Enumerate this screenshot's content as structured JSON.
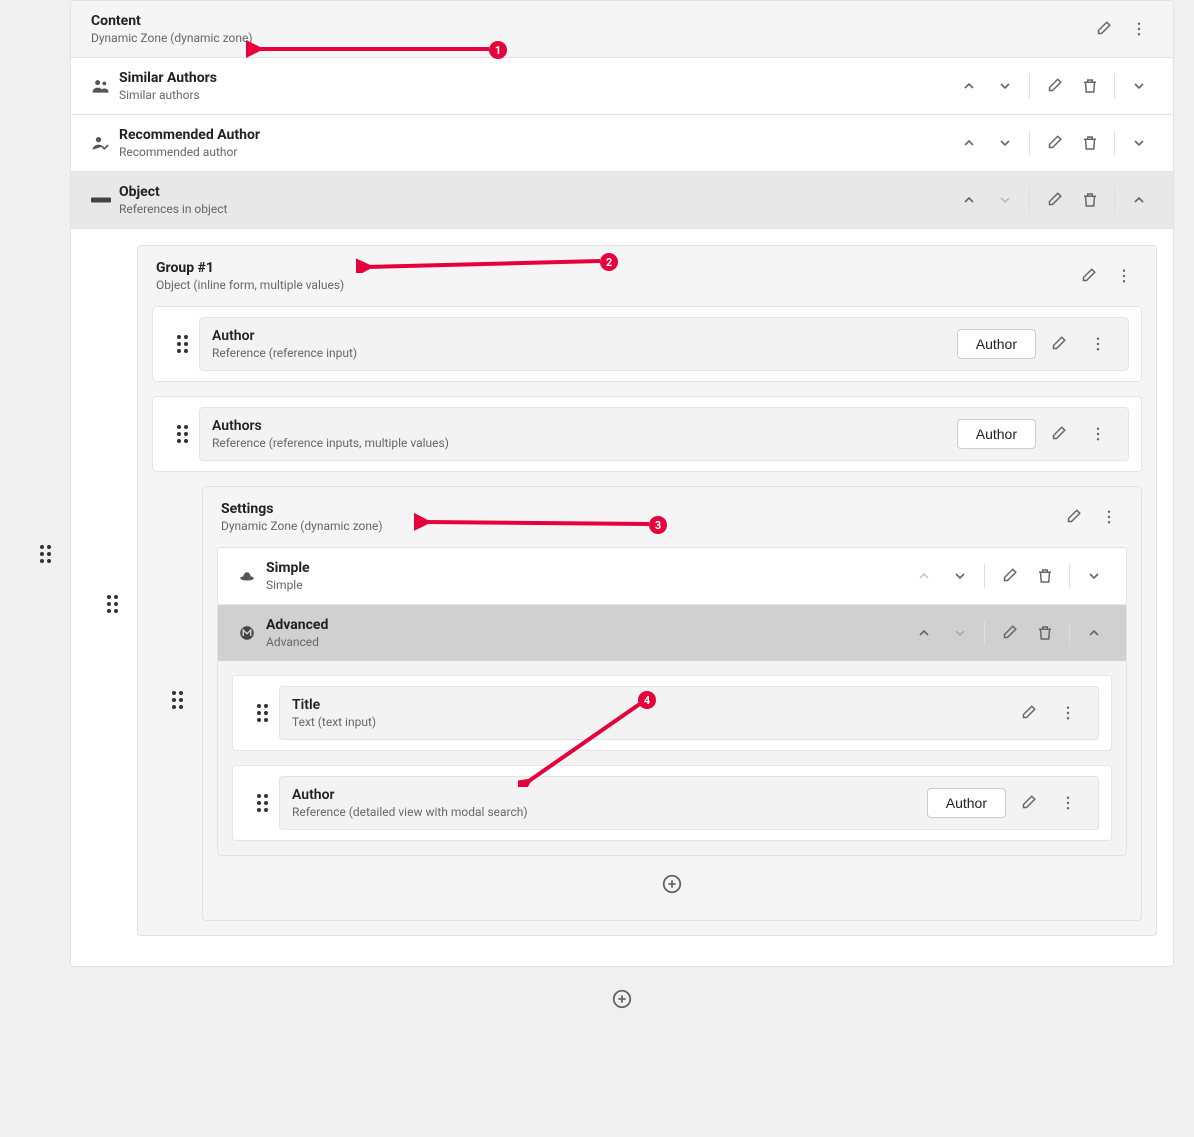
{
  "content": {
    "title": "Content",
    "subtitle": "Dynamic Zone (dynamic zone)"
  },
  "components": [
    {
      "title": "Similar Authors",
      "subtitle": "Similar authors"
    },
    {
      "title": "Recommended Author",
      "subtitle": "Recommended author"
    },
    {
      "title": "Object",
      "subtitle": "References in object"
    }
  ],
  "group1": {
    "title": "Group #1",
    "subtitle": "Object (inline form, multiple values)"
  },
  "fields": {
    "author": {
      "title": "Author",
      "subtitle": "Reference (reference input)",
      "btn": "Author"
    },
    "authors": {
      "title": "Authors",
      "subtitle": "Reference (reference inputs, multiple values)",
      "btn": "Author"
    }
  },
  "settings": {
    "title": "Settings",
    "subtitle": "Dynamic Zone (dynamic zone)",
    "simple": {
      "title": "Simple",
      "subtitle": "Simple"
    },
    "advanced": {
      "title": "Advanced",
      "subtitle": "Advanced"
    },
    "children": {
      "title_field": {
        "title": "Title",
        "subtitle": "Text (text input)"
      },
      "author_field": {
        "title": "Author",
        "subtitle": "Reference (detailed view with modal search)",
        "btn": "Author"
      }
    }
  },
  "annotations": [
    "1",
    "2",
    "3",
    "4"
  ]
}
